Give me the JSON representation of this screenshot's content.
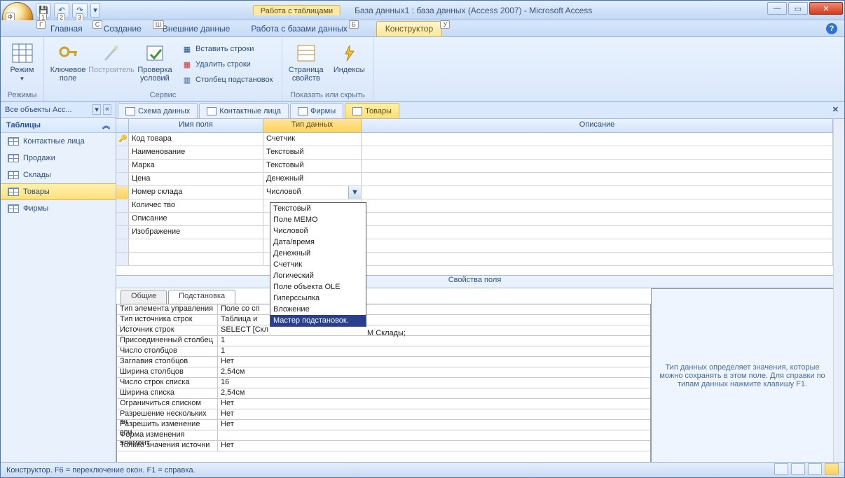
{
  "window": {
    "app_title": "База данных1 : база данных (Access 2007) - Microsoft Access",
    "contextual_header": "Работа с таблицами",
    "qat_badge": "Ф",
    "qat_keys": [
      "1",
      "2",
      "3"
    ],
    "ribbon_tabs": [
      {
        "label": "Главная",
        "key": "Г"
      },
      {
        "label": "Создание",
        "key": "С"
      },
      {
        "label": "Внешние данные",
        "key": "Ш"
      },
      {
        "label": "Работа с базами данных",
        "key": "Б"
      }
    ],
    "contextual_tab": {
      "label": "Конструктор",
      "key": "У"
    }
  },
  "ribbon": {
    "groups": {
      "modes": {
        "label": "Режимы",
        "btn": "Режим"
      },
      "service": {
        "label": "Сервис",
        "key_field": "Ключевое поле",
        "builder": "Построитель",
        "test_conditions": "Проверка условий",
        "insert_rows": "Вставить строки",
        "delete_rows": "Удалить строки",
        "lookup_column": "Столбец подстановок"
      },
      "show_hide": {
        "label": "Показать или скрыть",
        "property_sheet": "Страница свойств",
        "indexes": "Индексы"
      }
    }
  },
  "nav": {
    "header": "Все объекты Acc...",
    "group": "Таблицы",
    "items": [
      {
        "label": "Контактные лица"
      },
      {
        "label": "Продажи"
      },
      {
        "label": "Склады"
      },
      {
        "label": "Товары",
        "selected": true
      },
      {
        "label": "Фирмы"
      }
    ]
  },
  "doc_tabs": [
    {
      "label": "Схема данных"
    },
    {
      "label": "Контактные лица"
    },
    {
      "label": "Фирмы"
    },
    {
      "label": "Товары",
      "active": true
    }
  ],
  "design": {
    "col_name": "Имя поля",
    "col_type": "Тип данных",
    "col_desc": "Описание",
    "rows": [
      {
        "name": "Код товара",
        "type": "Счетчик",
        "pk": true
      },
      {
        "name": "Наименование",
        "type": "Текстовый"
      },
      {
        "name": "Марка",
        "type": "Текстовый"
      },
      {
        "name": "Цена",
        "type": "Денежный"
      },
      {
        "name": "Номер склада",
        "type": "Числовой",
        "active": true
      },
      {
        "name": "Количес тво",
        "type": ""
      },
      {
        "name": "Описание",
        "type": ""
      },
      {
        "name": "Изображение",
        "type": ""
      }
    ],
    "type_dropdown": [
      "Текстовый",
      "Поле МЕМО",
      "Числовой",
      "Дата/время",
      "Денежный",
      "Счетчик",
      "Логический",
      "Поле объекта OLE",
      "Гиперссылка",
      "Вложение",
      "Мастер подстановок."
    ],
    "dropdown_selected": "Мастер подстановок."
  },
  "field_props": {
    "title": "Свойства поля",
    "tab_general": "Общие",
    "tab_lookup": "Подстановка",
    "rows": [
      {
        "k": "Тип элемента управления",
        "v": "Поле со сп"
      },
      {
        "k": "Тип источника строк",
        "v": "Таблица и"
      },
      {
        "k": "Источник строк",
        "v": "SELECT [Скл"
      },
      {
        "k": "Присоединенный столбец",
        "v": "1"
      },
      {
        "k": "Число столбцов",
        "v": "1"
      },
      {
        "k": "Заглавия столбцов",
        "v": "Нет"
      },
      {
        "k": "Ширина столбцов",
        "v": "2,54см"
      },
      {
        "k": "Число строк списка",
        "v": "16"
      },
      {
        "k": "Ширина списка",
        "v": "2,54см"
      },
      {
        "k": "Ограничиться списком",
        "v": "Нет"
      },
      {
        "k": "Разрешение нескольких зн",
        "v": "Нет"
      },
      {
        "k": "Разрешить изменение спи",
        "v": "Нет"
      },
      {
        "k": "Форма изменения элемент",
        "v": ""
      },
      {
        "k": "Только значения источни",
        "v": "Нет"
      }
    ],
    "row_source_full": "М Склады;",
    "help_text": "Тип данных определяет значения, которые можно сохранять в этом поле.  Для справки по типам данных нажмите клавишу F1."
  },
  "statusbar": {
    "text": "Конструктор.  F6 = переключение окон.  F1 = справка."
  }
}
